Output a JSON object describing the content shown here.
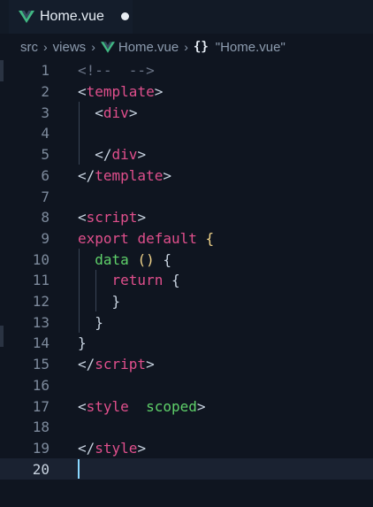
{
  "tab": {
    "label": "Home.vue",
    "icon": "vue-icon",
    "modified": true
  },
  "breadcrumb": {
    "items": [
      "src",
      "views",
      "Home.vue"
    ],
    "symbol": "\"Home.vue\"",
    "symbol_icon": "braces-icon"
  },
  "editor": {
    "active_line": 20,
    "lines": [
      {
        "n": "1",
        "tokens": [
          {
            "t": "<!--  -->",
            "k": "comment"
          }
        ]
      },
      {
        "n": "2",
        "tokens": [
          {
            "t": "<",
            "k": "punct"
          },
          {
            "t": "template",
            "k": "tag"
          },
          {
            "t": ">",
            "k": "punct"
          }
        ]
      },
      {
        "n": "3",
        "tokens": [
          {
            "t": "  <",
            "k": "punct"
          },
          {
            "t": "div",
            "k": "tag"
          },
          {
            "t": ">",
            "k": "punct"
          }
        ]
      },
      {
        "n": "4",
        "tokens": []
      },
      {
        "n": "5",
        "tokens": [
          {
            "t": "  </",
            "k": "punct"
          },
          {
            "t": "div",
            "k": "tag"
          },
          {
            "t": ">",
            "k": "punct"
          }
        ]
      },
      {
        "n": "6",
        "tokens": [
          {
            "t": "</",
            "k": "punct"
          },
          {
            "t": "template",
            "k": "tag"
          },
          {
            "t": ">",
            "k": "punct"
          }
        ]
      },
      {
        "n": "7",
        "tokens": []
      },
      {
        "n": "8",
        "tokens": [
          {
            "t": "<",
            "k": "punct"
          },
          {
            "t": "script",
            "k": "tag"
          },
          {
            "t": ">",
            "k": "punct"
          }
        ]
      },
      {
        "n": "9",
        "tokens": [
          {
            "t": "export",
            "k": "keyword"
          },
          {
            "t": " ",
            "k": "punct"
          },
          {
            "t": "default",
            "k": "keyword"
          },
          {
            "t": " ",
            "k": "punct"
          },
          {
            "t": "{",
            "k": "brace"
          }
        ]
      },
      {
        "n": "10",
        "tokens": [
          {
            "t": "  ",
            "k": "punct"
          },
          {
            "t": "data",
            "k": "func"
          },
          {
            "t": " ",
            "k": "punct"
          },
          {
            "t": "()",
            "k": "paren"
          },
          {
            "t": " ",
            "k": "punct"
          },
          {
            "t": "{",
            "k": "punct"
          }
        ]
      },
      {
        "n": "11",
        "tokens": [
          {
            "t": "    ",
            "k": "punct"
          },
          {
            "t": "return",
            "k": "keyword"
          },
          {
            "t": " {",
            "k": "punct"
          }
        ]
      },
      {
        "n": "12",
        "tokens": [
          {
            "t": "    }",
            "k": "punct"
          }
        ]
      },
      {
        "n": "13",
        "tokens": [
          {
            "t": "  }",
            "k": "punct"
          }
        ]
      },
      {
        "n": "14",
        "tokens": [
          {
            "t": "}",
            "k": "punct"
          }
        ]
      },
      {
        "n": "15",
        "tokens": [
          {
            "t": "</",
            "k": "punct"
          },
          {
            "t": "script",
            "k": "tag"
          },
          {
            "t": ">",
            "k": "punct"
          }
        ]
      },
      {
        "n": "16",
        "tokens": []
      },
      {
        "n": "17",
        "tokens": [
          {
            "t": "<",
            "k": "punct"
          },
          {
            "t": "style",
            "k": "tag"
          },
          {
            "t": "  ",
            "k": "punct"
          },
          {
            "t": "scoped",
            "k": "attr"
          },
          {
            "t": ">",
            "k": "punct"
          }
        ]
      },
      {
        "n": "18",
        "tokens": []
      },
      {
        "n": "19",
        "tokens": [
          {
            "t": "</",
            "k": "punct"
          },
          {
            "t": "style",
            "k": "tag"
          },
          {
            "t": ">",
            "k": "punct"
          }
        ]
      },
      {
        "n": "20",
        "tokens": []
      }
    ]
  },
  "colors": {
    "background": "#0f1520",
    "tag": "#e04f8c",
    "attribute": "#5fd16a",
    "brace": "#f1d48a",
    "comment": "#6a7486",
    "line_number": "#7d8a9c",
    "cursor": "#8ad8ff",
    "vue_green": "#41b883"
  }
}
